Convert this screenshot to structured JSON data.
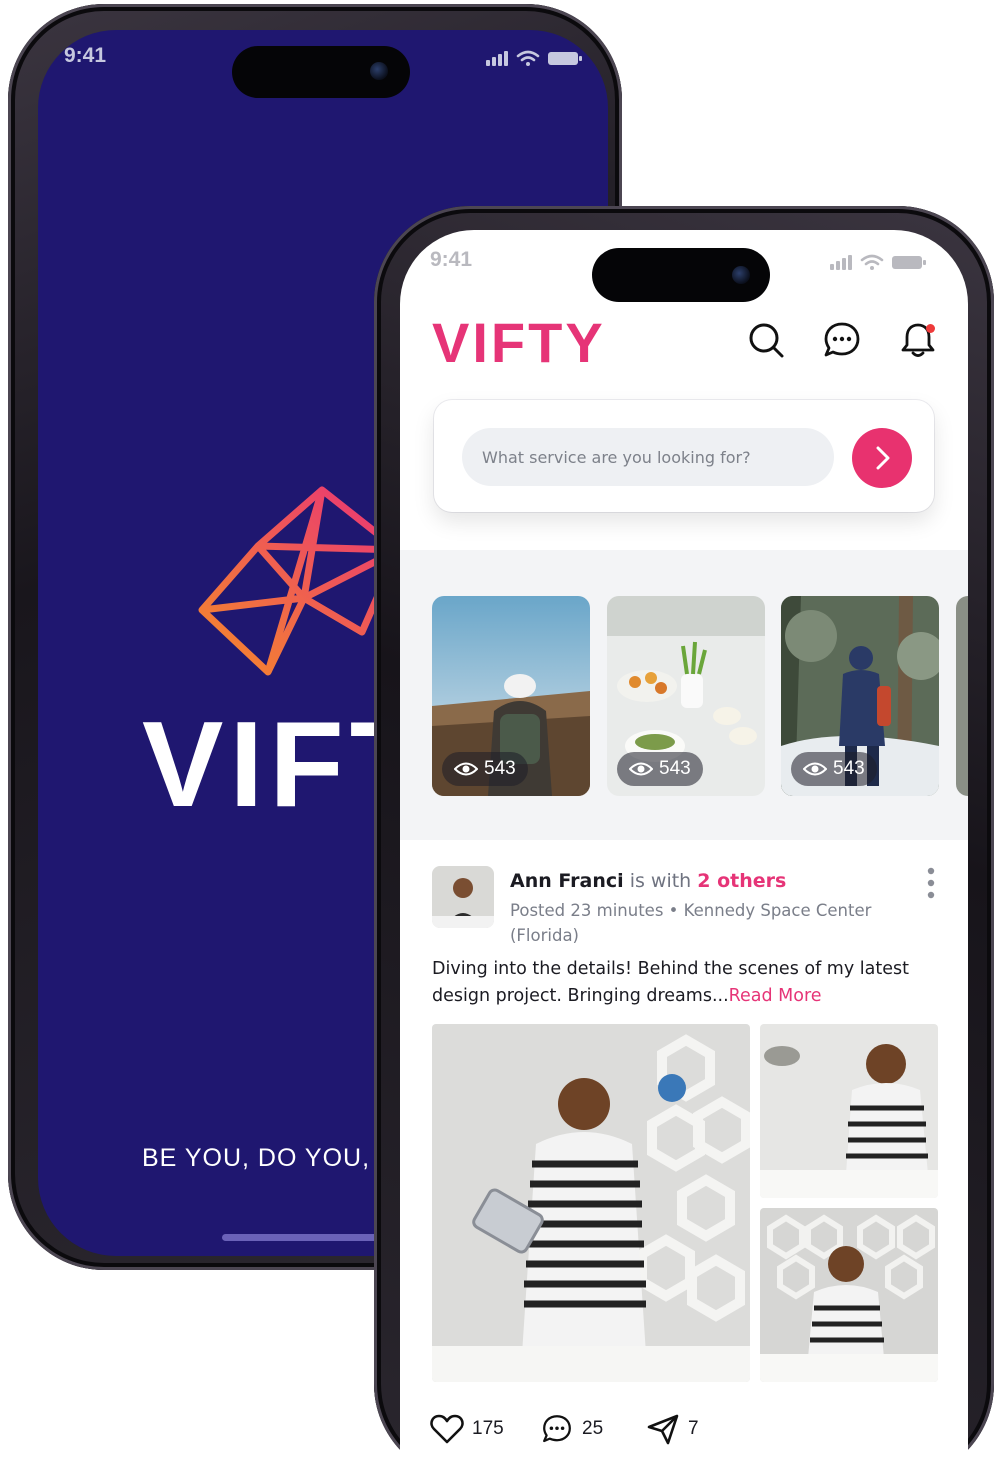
{
  "splash": {
    "time": "9:41",
    "brand": "VIFTY",
    "tagline": "BE YOU, DO YOU, FI",
    "background_color": "#1f1770"
  },
  "feed": {
    "time": "9:41",
    "brand": "VIFTY",
    "brand_color": "#e63477",
    "header_icons": [
      "search-icon",
      "chat-icon",
      "bell-icon"
    ],
    "search": {
      "placeholder": "What service are you looking for?",
      "button_icon": "chevron-right-icon"
    },
    "stories": [
      {
        "views": "543",
        "scene": "hiker-cliff"
      },
      {
        "views": "543",
        "scene": "food-table"
      },
      {
        "views": "543",
        "scene": "snow-hiker"
      }
    ],
    "post": {
      "author": "Ann Franci",
      "with_text": "is with",
      "others": "2 others",
      "meta": "Posted 23 minutes • Kennedy Space Center (Florida)",
      "text": "Diving into the details! Behind the scenes of my latest design project. Bringing dreams...",
      "read_more": "Read More",
      "likes": "175",
      "comments": "25",
      "shares": "7"
    }
  }
}
